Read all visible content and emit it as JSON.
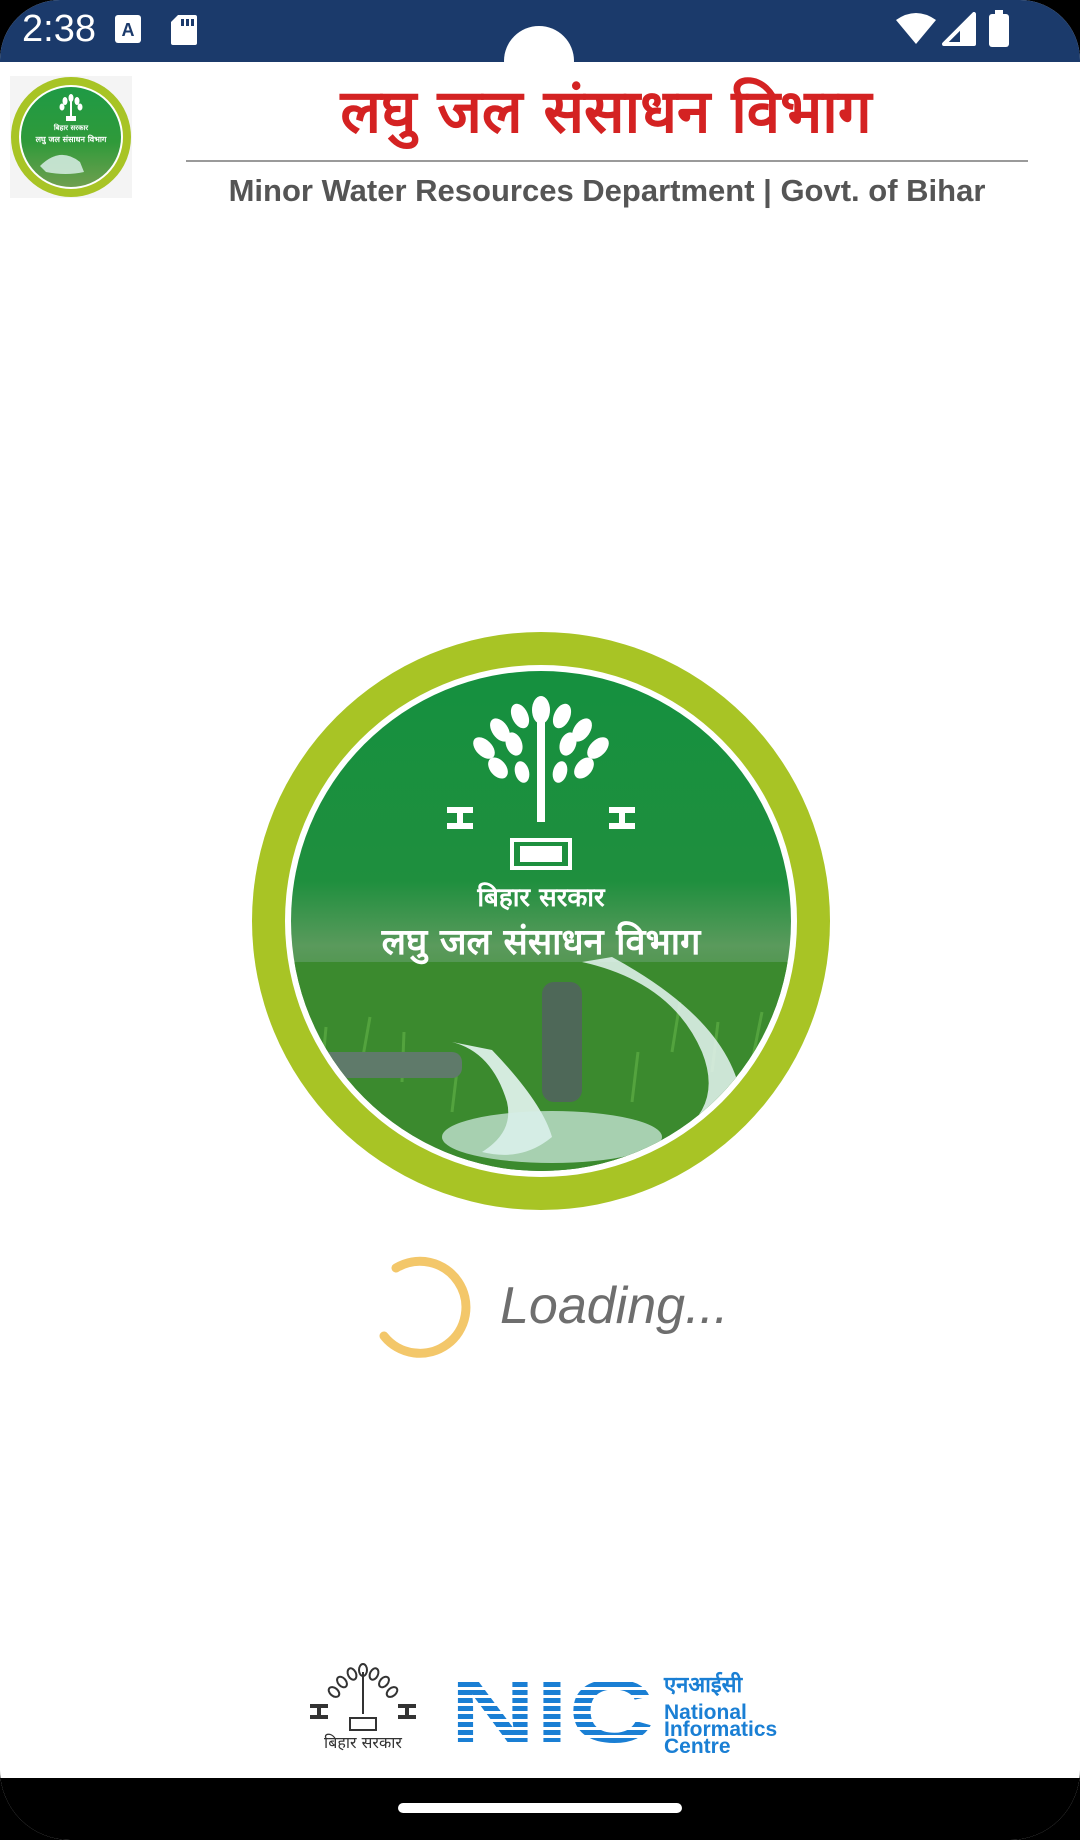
{
  "status_bar": {
    "time": "2:38",
    "icons": [
      "a-notification-icon",
      "sd-card-icon",
      "wifi-icon",
      "signal-icon",
      "battery-icon"
    ]
  },
  "header": {
    "title_hi": "लघु जल संसाधन विभाग",
    "subtitle_en": "Minor Water Resources Department | Govt. of Bihar"
  },
  "emblem": {
    "top_text": "बिहार सरकार",
    "main_text": "लघु जल संसाधन विभाग"
  },
  "header_logo": {
    "top_text": "बिहार सरकार",
    "main_text": "लघु जल संसाधन विभाग"
  },
  "loading": {
    "text": "Loading..."
  },
  "footer": {
    "bihar_text": "बिहार सरकार",
    "nic_hi": "एनआईसी",
    "nic_en_line1": "National",
    "nic_en_line2": "Informatics",
    "nic_en_line3": "Centre",
    "nic_logo_text": "NIC"
  },
  "colors": {
    "status_bar": "#1b3a6b",
    "title_red": "#d42222",
    "emblem_ring": "#a8c425",
    "emblem_green": "#1e8a3c",
    "spinner": "#f3c76a",
    "nic_blue": "#1a7fd4"
  }
}
